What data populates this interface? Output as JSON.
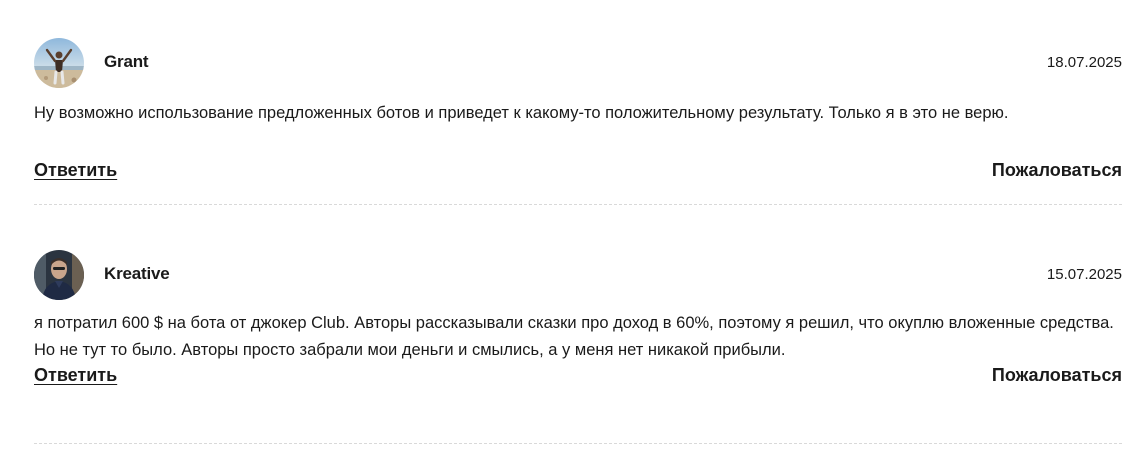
{
  "comments": [
    {
      "author": "Grant",
      "date": "18.07.2025",
      "text": "Ну возможно использование предложенных ботов и приведет к какому-то положительному результату. Только я в это не верю.",
      "reply_label": "Ответить",
      "complain_label": "Пожаловаться"
    },
    {
      "author": "Kreative",
      "date": "15.07.2025",
      "text": "я потратил 600 $ на бота от джокер Club. Авторы рассказывали сказки про доход в 60%, поэтому я решил, что окуплю вложенные средства. Но не тут то было. Авторы просто забрали мои деньги и смылись, а у меня нет никакой прибыли.",
      "reply_label": "Ответить",
      "complain_label": "Пожаловаться"
    }
  ]
}
